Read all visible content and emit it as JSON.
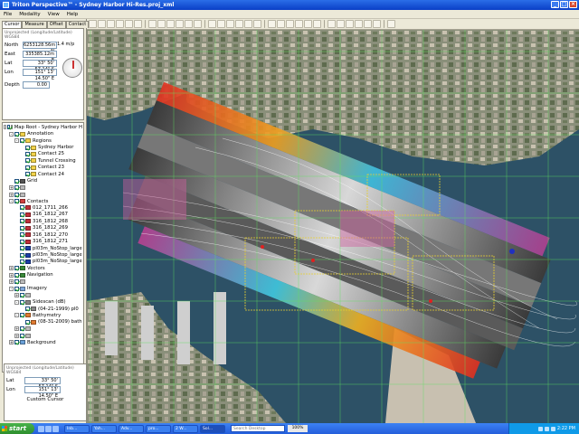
{
  "window": {
    "title": "Triton Perspective™ - Sydney Harbor Hi-Res.proj_xml"
  },
  "menu": [
    "File",
    "Modality",
    "View",
    "Help"
  ],
  "tabs": [
    "Cursor",
    "Measure",
    "Offset",
    "Contact"
  ],
  "cursor_panel": {
    "header": "Unprojected (Longitude/Latitude)",
    "datum": "WGS84",
    "north_label": "North",
    "north_value": "6253128.56m N",
    "east_label": "East",
    "east_value": "335385.12m E",
    "lat_label": "Lat",
    "lat_value": "33° 50' 57.14\" S",
    "lon_label": "Lon",
    "lon_value": "151° 13' 14.50\" E",
    "speed": "1.4 m/p",
    "depth_label": "Depth",
    "depth_value": "0.00"
  },
  "tree": [
    {
      "label": "Map Root - Sydney Harbor H",
      "indent": 0,
      "exp": "-",
      "icon": "#c9c9c9"
    },
    {
      "label": "Annotation",
      "indent": 1,
      "exp": "-",
      "icon": "#f2d24a"
    },
    {
      "label": "Regions",
      "indent": 2,
      "exp": "-",
      "icon": "#f2d24a"
    },
    {
      "label": "Sydney Harbor",
      "indent": 3,
      "exp": "",
      "icon": "#f2d24a"
    },
    {
      "label": "Contact 25",
      "indent": 3,
      "exp": "",
      "icon": "#f2d24a"
    },
    {
      "label": "Tunnel Crossing",
      "indent": 3,
      "exp": "",
      "icon": "#f2d24a"
    },
    {
      "label": "Contact 23",
      "indent": 3,
      "exp": "",
      "icon": "#f2d24a"
    },
    {
      "label": "Contact 24",
      "indent": 3,
      "exp": "",
      "icon": "#f2d24a"
    },
    {
      "label": "Grid",
      "indent": 1,
      "exp": "",
      "icon": "#555555"
    },
    {
      "label": "",
      "indent": 1,
      "exp": "+",
      "icon": "#bbbbbb"
    },
    {
      "label": "",
      "indent": 1,
      "exp": "+",
      "icon": "#bbbbbb"
    },
    {
      "label": "Contacts",
      "indent": 1,
      "exp": "-",
      "icon": "#d04040"
    },
    {
      "label": "012_1711_266",
      "indent": 2,
      "exp": "",
      "icon": "#c0303a"
    },
    {
      "label": "316_1812_267",
      "indent": 2,
      "exp": "",
      "icon": "#c0303a"
    },
    {
      "label": "316_1812_268",
      "indent": 2,
      "exp": "",
      "icon": "#c0303a"
    },
    {
      "label": "316_1812_269",
      "indent": 2,
      "exp": "",
      "icon": "#c0303a"
    },
    {
      "label": "316_1812_270",
      "indent": 2,
      "exp": "",
      "icon": "#c0303a"
    },
    {
      "label": "316_1812_271",
      "indent": 2,
      "exp": "",
      "icon": "#c0303a"
    },
    {
      "label": "pl03m_NoStop_large",
      "indent": 2,
      "exp": "",
      "icon": "#1b3ea8"
    },
    {
      "label": "pl03m_NoStop_large",
      "indent": 2,
      "exp": "",
      "icon": "#1b3ea8"
    },
    {
      "label": "pl03m_NoStop_large",
      "indent": 2,
      "exp": "",
      "icon": "#1b3ea8"
    },
    {
      "label": "Vectors",
      "indent": 1,
      "exp": "+",
      "icon": "#3a8a3a"
    },
    {
      "label": "Navigation",
      "indent": 1,
      "exp": "+",
      "icon": "#3a8a3a"
    },
    {
      "label": "",
      "indent": 1,
      "exp": "+",
      "icon": "#bbbbbb"
    },
    {
      "label": "Imagery",
      "indent": 1,
      "exp": "-",
      "icon": "#7fa7d8"
    },
    {
      "label": "",
      "indent": 2,
      "exp": "+",
      "icon": "#bbbbbb"
    },
    {
      "label": "Sidescan (dB)",
      "indent": 2,
      "exp": "-",
      "icon": "#888888"
    },
    {
      "label": "(04-21-1999) pl0",
      "indent": 3,
      "exp": "",
      "icon": "#888888"
    },
    {
      "label": "Bathymetry",
      "indent": 2,
      "exp": "-",
      "icon": "#e07a30"
    },
    {
      "label": "(08-31-2009) bath",
      "indent": 3,
      "exp": "",
      "icon": "#e07a30"
    },
    {
      "label": "",
      "indent": 2,
      "exp": "+",
      "icon": "#bbbbbb"
    },
    {
      "label": "",
      "indent": 2,
      "exp": "+",
      "icon": "#bbbbbb"
    },
    {
      "label": "Background",
      "indent": 1,
      "exp": "+",
      "icon": "#6aa0d8"
    }
  ],
  "bottom_panel": {
    "header": "Unprojected (Longitude/Latitude)",
    "datum": "WGS84",
    "lat_label": "Lat",
    "lat_value": "33° 50' 57.14\" S",
    "lon_label": "Lon",
    "lon_value": "151° 13' 14.50\" E",
    "custom_cursor": "Custom Cursor"
  },
  "taskbar": {
    "start": "start",
    "tasks": [
      "Inb...",
      "Yah...",
      "Adv...",
      "pro...",
      "2 W...",
      "Sol..."
    ],
    "search": "Search Desktop",
    "zoom": "100%",
    "clock": "2:22 PM"
  },
  "colors": {
    "titlebar": "#0a3fc6",
    "water": "#2d5166",
    "grid": "#5fe35f",
    "contours": "#ffffff",
    "region_outline": "#e8d030"
  }
}
